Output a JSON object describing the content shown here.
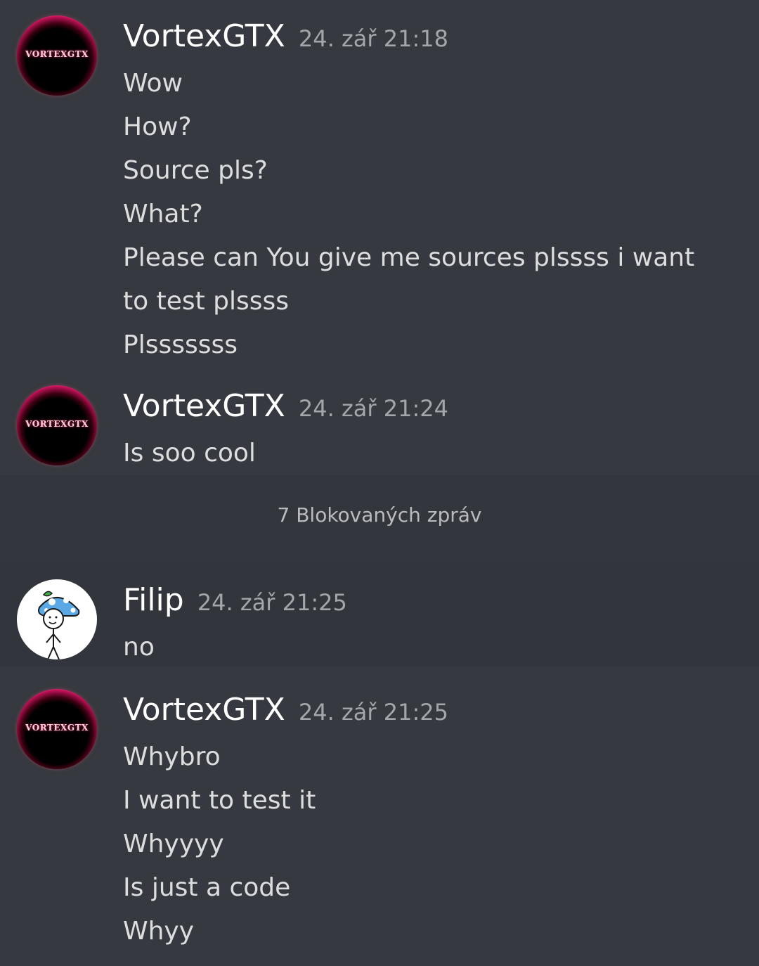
{
  "messages": [
    {
      "author": "VortexGTX",
      "avatar_text": "VORTEXGTX",
      "timestamp": "24. zář 21:18",
      "lines": [
        "Wow",
        "How?",
        "Source pls?",
        "What?",
        "Please can You give me sources plssss i want to test plssss",
        "Plsssssss"
      ]
    },
    {
      "author": "VortexGTX",
      "avatar_text": "VORTEXGTX",
      "timestamp": "24. zář 21:24",
      "lines": [
        "Is soo  cool"
      ]
    },
    {
      "author": "Filip",
      "timestamp": "24. zář 21:25",
      "lines": [
        "no"
      ]
    },
    {
      "author": "VortexGTX",
      "avatar_text": "VORTEXGTX",
      "timestamp": "24. zář 21:25",
      "lines": [
        "Whybro",
        "I want to test it",
        "Whyyyy",
        "Is just a code",
        "Whyy"
      ]
    }
  ],
  "blocked_notice": "7 Blokovaných zpráv",
  "colors": {
    "background": "#36393f",
    "username": "#ffffff",
    "timestamp": "#a3a6aa",
    "message_text": "#dcddde",
    "blocked_text": "#b9bbbe"
  },
  "icons": {
    "vortex_avatar": "neon-ring-logo-avatar",
    "filip_avatar": "mushroom-stick-figure-avatar"
  }
}
